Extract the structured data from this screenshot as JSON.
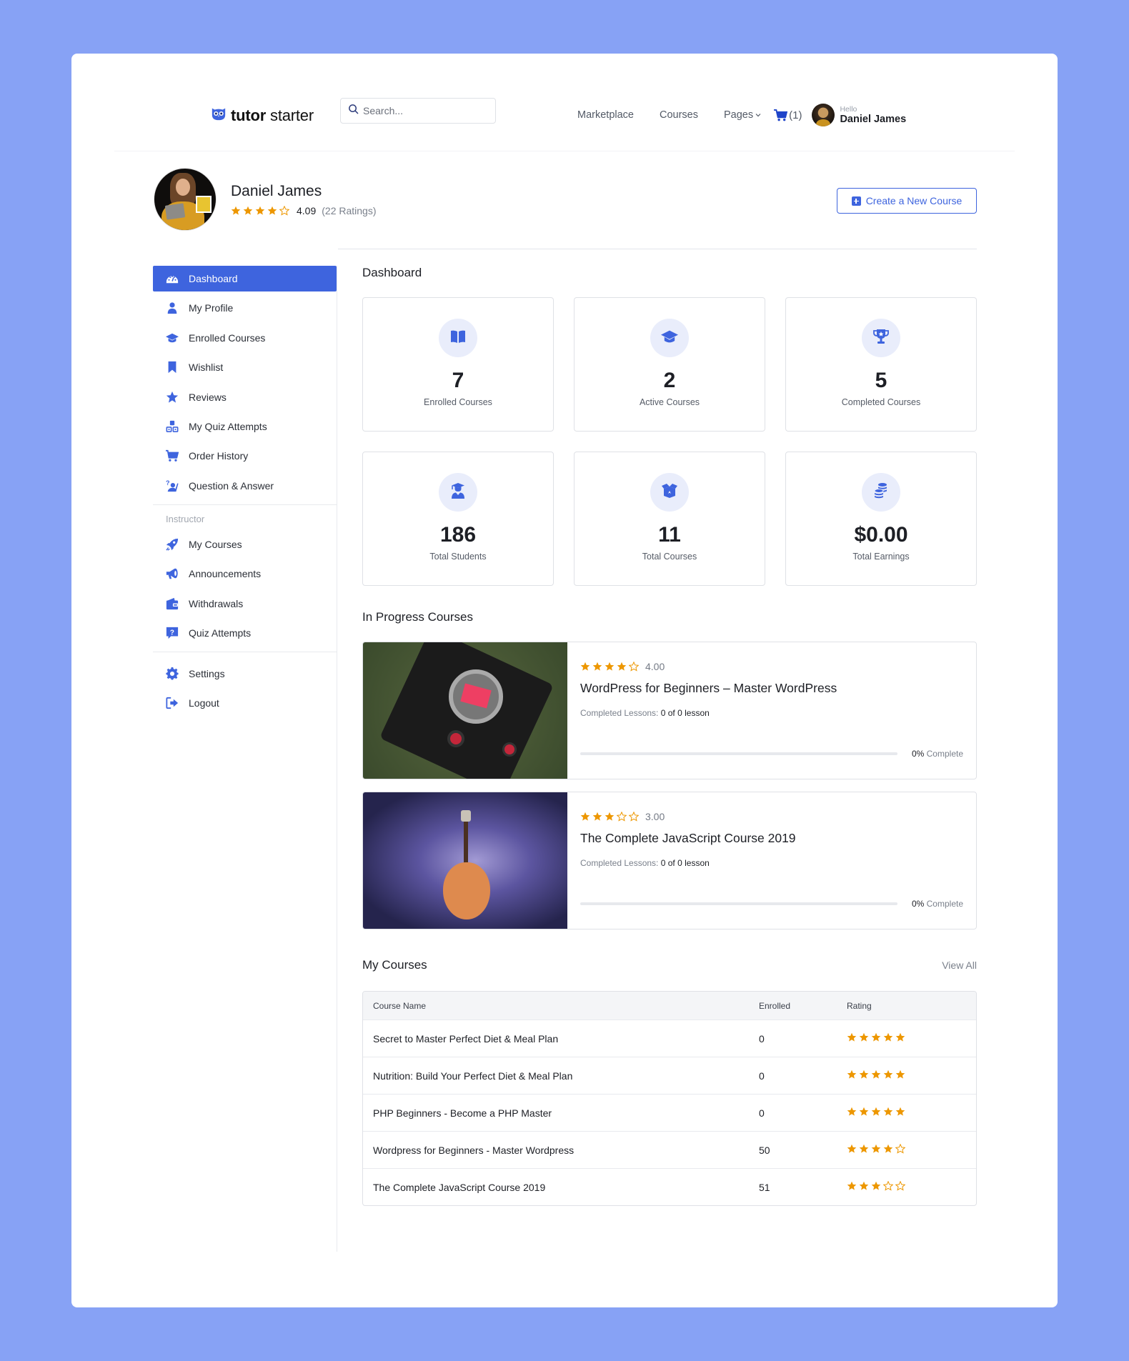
{
  "colors": {
    "accent": "#3e64de",
    "star": "#ed9700",
    "background": "#87a2f5"
  },
  "header": {
    "logo_bold": "tutor",
    "logo_light": "starter",
    "search_placeholder": "Search...",
    "nav": [
      "Marketplace",
      "Courses",
      "Pages"
    ],
    "cart_count": "(1)",
    "user_greeting": "Hello",
    "user_name": "Daniel James"
  },
  "profile": {
    "name": "Daniel James",
    "rating": 4.09,
    "rating_text": "4.09",
    "ratings_count": "(22 Ratings)",
    "create_button": "Create a New Course"
  },
  "sidebar": {
    "items": [
      {
        "label": "Dashboard",
        "icon": "dashboard-icon",
        "active": true
      },
      {
        "label": "My Profile",
        "icon": "user-icon"
      },
      {
        "label": "Enrolled Courses",
        "icon": "graduation-cap-icon"
      },
      {
        "label": "Wishlist",
        "icon": "bookmark-icon"
      },
      {
        "label": "Reviews",
        "icon": "star-icon"
      },
      {
        "label": "My Quiz Attempts",
        "icon": "quiz-blocks-icon"
      },
      {
        "label": "Order History",
        "icon": "cart-icon"
      },
      {
        "label": "Question & Answer",
        "icon": "question-answer-icon"
      }
    ],
    "instructor_title": "Instructor",
    "instructor_items": [
      {
        "label": "My Courses",
        "icon": "rocket-icon"
      },
      {
        "label": "Announcements",
        "icon": "megaphone-icon"
      },
      {
        "label": "Withdrawals",
        "icon": "wallet-icon"
      },
      {
        "label": "Quiz Attempts",
        "icon": "question-box-icon"
      }
    ],
    "bottom_items": [
      {
        "label": "Settings",
        "icon": "gear-icon"
      },
      {
        "label": "Logout",
        "icon": "logout-icon"
      }
    ]
  },
  "dashboard": {
    "title": "Dashboard",
    "stats": [
      {
        "value": "7",
        "label": "Enrolled Courses",
        "icon": "open-book-icon"
      },
      {
        "value": "2",
        "label": "Active Courses",
        "icon": "graduation-cap-icon"
      },
      {
        "value": "5",
        "label": "Completed Courses",
        "icon": "trophy-icon"
      },
      {
        "value": "186",
        "label": "Total Students",
        "icon": "student-icon"
      },
      {
        "value": "11",
        "label": "Total Courses",
        "icon": "box-icon"
      },
      {
        "value": "$0.00",
        "label": "Total Earnings",
        "icon": "coins-icon"
      }
    ]
  },
  "in_progress": {
    "title": "In Progress Courses",
    "courses": [
      {
        "rating": 4,
        "rating_text": "4.00",
        "title": "WordPress for Beginners – Master WordPress",
        "lessons_label": "Completed Lessons:",
        "lessons_value": "0 of 0 lesson",
        "progress": 0,
        "progress_pct": "0%",
        "progress_suffix": "Complete",
        "thumbnail": "camera"
      },
      {
        "rating": 3,
        "rating_text": "3.00",
        "title": "The Complete JavaScript Course 2019",
        "lessons_label": "Completed Lessons:",
        "lessons_value": "0 of 0 lesson",
        "progress": 0,
        "progress_pct": "0%",
        "progress_suffix": "Complete",
        "thumbnail": "guitar"
      }
    ]
  },
  "my_courses": {
    "title": "My Courses",
    "view_all": "View All",
    "columns": [
      "Course Name",
      "Enrolled",
      "Rating"
    ],
    "rows": [
      {
        "name": "Secret to Master Perfect Diet & Meal Plan",
        "enrolled": "0",
        "rating": 5
      },
      {
        "name": "Nutrition: Build Your Perfect Diet & Meal Plan",
        "enrolled": "0",
        "rating": 5
      },
      {
        "name": "PHP Beginners - Become a PHP Master",
        "enrolled": "0",
        "rating": 5
      },
      {
        "name": "Wordpress for Beginners - Master Wordpress",
        "enrolled": "50",
        "rating": 4
      },
      {
        "name": "The Complete JavaScript Course 2019",
        "enrolled": "51",
        "rating": 3
      }
    ]
  }
}
